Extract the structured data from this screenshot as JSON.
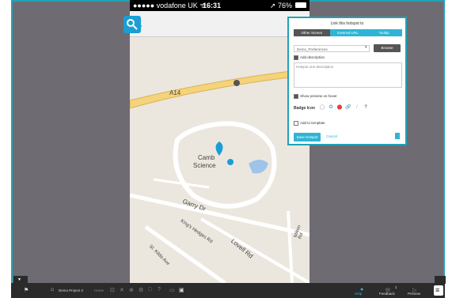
{
  "phone": {
    "carrier": "●●●●● vodafone UK ᯤ",
    "time": "16:31",
    "battery": "➚ 76%"
  },
  "map": {
    "labels": [
      "A14",
      "Camb",
      "Science",
      "Garry Dr",
      "King's Hedges Rd",
      "Lovell Rd",
      "St. Kilda Ave",
      "Milton Rd"
    ]
  },
  "modal": {
    "title": "Link this hotspot to",
    "tabs": [
      "Other Screen",
      "External URL",
      "Tooltip"
    ],
    "screen_select": "Demo_Preferences",
    "browse_label": "Browse",
    "add_description_label": "Add description",
    "description_placeholder": "Hotspot one description",
    "show_preview_label": "Show preview on hover",
    "badge_icon_label": "Badge Icon",
    "badge_icons": [
      "◯",
      "✪",
      "⬤",
      "🔗",
      "/",
      "?"
    ],
    "add_template_label": "Add to template",
    "save_label": "Save Hotspot",
    "cancel_label": "Cancel"
  },
  "footer": {
    "project_name": "Demo Project 2",
    "breadcrumb": "Home",
    "help_label": "Help",
    "feedback_label": "Feedback",
    "preview_label": "Preview",
    "help_count": "1"
  },
  "colors": {
    "accent": "#1fa3b5",
    "primary_blue": "#2fb4d4"
  }
}
